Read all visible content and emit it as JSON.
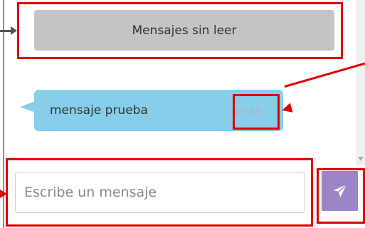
{
  "chat": {
    "unread_label": "Mensajes sin leer",
    "messages": [
      {
        "text": "mensaje prueba",
        "time": "09:49"
      }
    ]
  },
  "composer": {
    "placeholder": "Escribe un mensaje",
    "value": ""
  },
  "icons": {
    "send": "paper-plane-icon"
  },
  "colors": {
    "bubble": "#87ceeb",
    "unread_bar": "#c4c4c4",
    "send_button": "#9a86c6",
    "annotation": "#e00000"
  }
}
